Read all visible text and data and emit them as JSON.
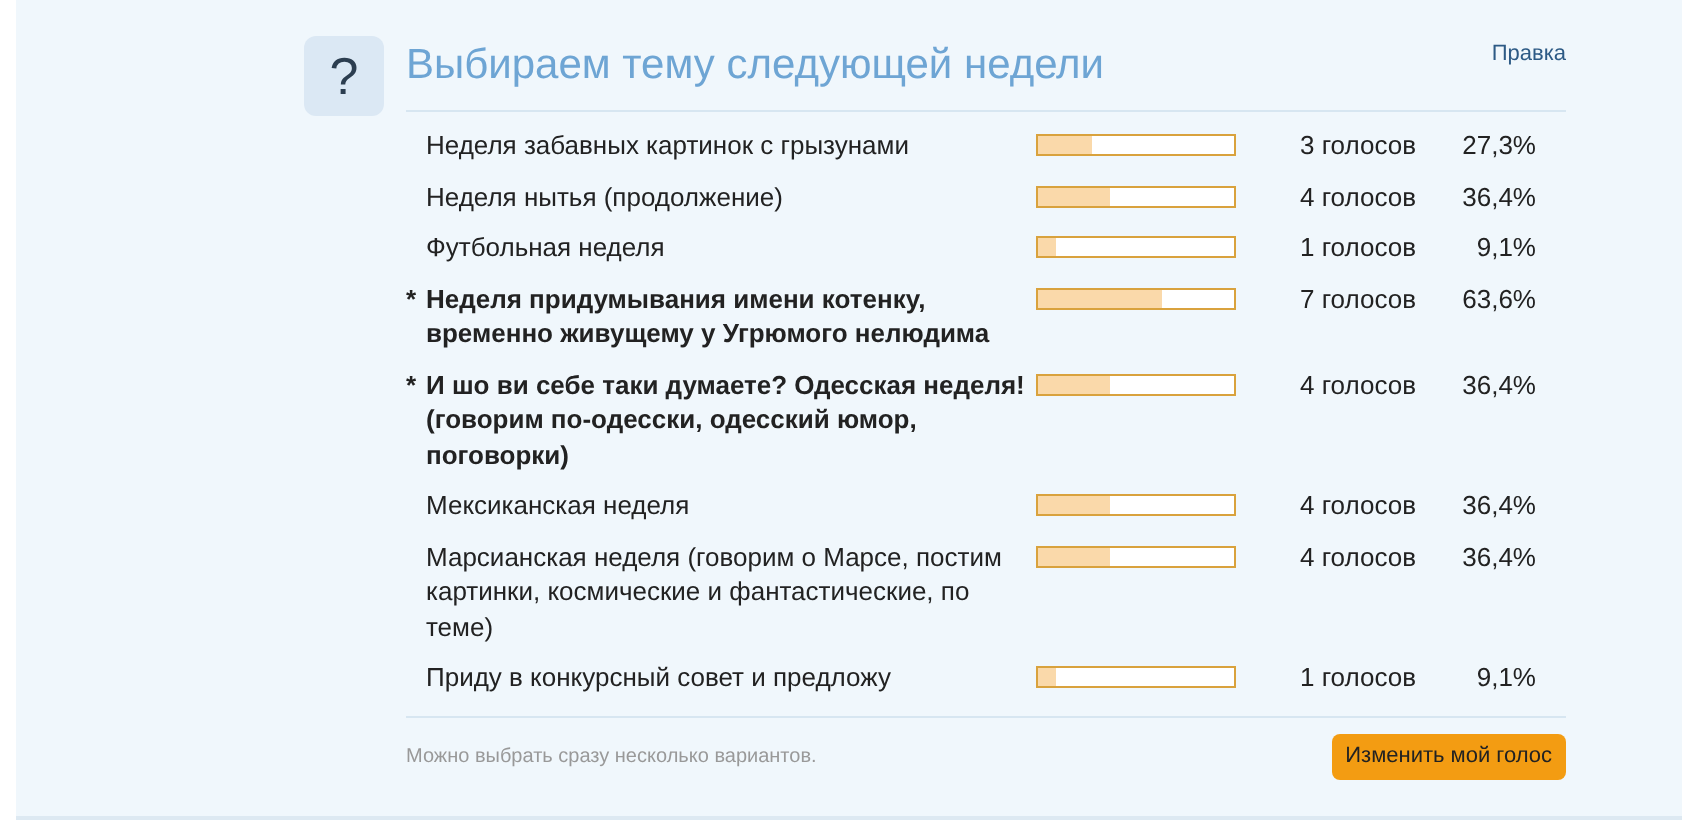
{
  "poll": {
    "icon": "?",
    "title": "Выбираем тему следующей недели",
    "edit_link": "Правка",
    "options": [
      {
        "label": "Неделя забавных картинок с грызунами",
        "voted": false,
        "level": 0.273,
        "votes": "3 голосов",
        "percent": "27,3%"
      },
      {
        "label": "Неделя нытья (продолжение)",
        "voted": false,
        "level": 0.364,
        "votes": "4 голосов",
        "percent": "36,4%"
      },
      {
        "label": "Футбольная неделя",
        "voted": false,
        "level": 0.091,
        "votes": "1 голосов",
        "percent": "9,1%"
      },
      {
        "label": "Неделя придумывания имени котенку, временно живущему у Угрюмого нелюдима",
        "voted": true,
        "mark": "*",
        "level": 0.636,
        "votes": "7 голосов",
        "percent": "63,6%"
      },
      {
        "label": "И шо ви себе таки думаете? Одесская неделя! (говорим по-одесски, одесский юмор, поговорки)",
        "voted": true,
        "mark": "*",
        "level": 0.364,
        "votes": "4 голосов",
        "percent": "36,4%"
      },
      {
        "label": "Мексиканская неделя",
        "voted": false,
        "level": 0.364,
        "votes": "4 голосов",
        "percent": "36,4%"
      },
      {
        "label": "Марсианская неделя (говорим о Марсе, постим картинки, космические и фантастические, по теме)",
        "voted": false,
        "level": 0.364,
        "votes": "4 голосов",
        "percent": "36,4%"
      },
      {
        "label": "Приду в конкурсный совет и предложу",
        "voted": false,
        "level": 0.091,
        "votes": "1 голосов",
        "percent": "9,1%"
      }
    ],
    "note": "Можно выбрать сразу несколько вариантов.",
    "button": "Изменить мой голос"
  }
}
